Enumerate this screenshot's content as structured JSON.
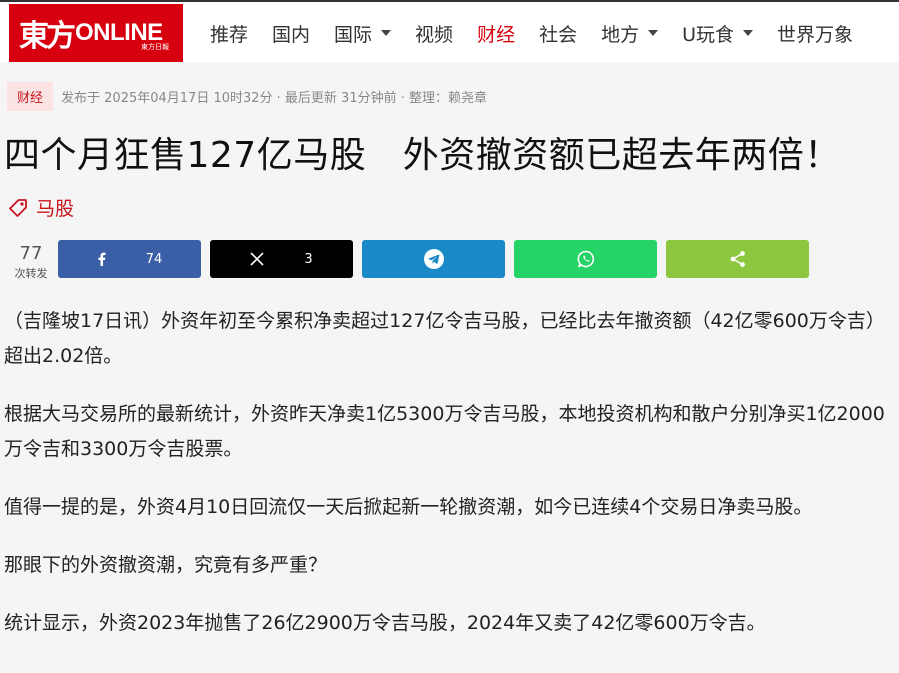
{
  "site": {
    "logo_mark": "東方",
    "logo_text": "ONLINE",
    "logo_sub": "東方日報"
  },
  "nav": {
    "items": [
      {
        "label": "推荐",
        "dropdown": false,
        "active": false
      },
      {
        "label": "国内",
        "dropdown": false,
        "active": false
      },
      {
        "label": "国际",
        "dropdown": true,
        "active": false
      },
      {
        "label": "视频",
        "dropdown": false,
        "active": false
      },
      {
        "label": "财经",
        "dropdown": false,
        "active": true
      },
      {
        "label": "社会",
        "dropdown": false,
        "active": false
      },
      {
        "label": "地方",
        "dropdown": true,
        "active": false
      },
      {
        "label": "U玩食",
        "dropdown": true,
        "active": false
      },
      {
        "label": "世界万象",
        "dropdown": false,
        "active": false
      }
    ]
  },
  "meta": {
    "category": "财经",
    "info": "发布于 2025年04月17日 10时32分 · 最后更新 31分钟前 · 整理：赖尧章"
  },
  "article": {
    "title": "四个月狂售127亿马股　外资撤资额已超去年两倍！",
    "tag": "马股",
    "paragraphs": [
      "（吉隆坡17日讯）外资年初至今累积净卖超过127亿令吉马股，已经比去年撤资额（42亿零600万令吉）超出2.02倍。",
      "根据大马交易所的最新统计，外资昨天净卖1亿5300万令吉马股，本地投资机构和散户分别净买1亿2000万令吉和3300万令吉股票。",
      "值得一提的是，外资4月10日回流仅一天后掀起新一轮撤资潮，如今已连续4个交易日净卖马股。",
      "那眼下的外资撤资潮，究竟有多严重？",
      "统计显示，外资2023年抛售了26亿2900万令吉马股，2024年又卖了42亿零600万令吉。"
    ]
  },
  "share": {
    "total": "77",
    "total_label": "次转发",
    "facebook_count": "74",
    "x_count": "3"
  },
  "colors": {
    "brand_red": "#d7000f",
    "facebook": "#3b5fa6",
    "x": "#000000",
    "telegram": "#1a89c8",
    "whatsapp": "#25d366",
    "sharethis": "#8dc63f"
  }
}
